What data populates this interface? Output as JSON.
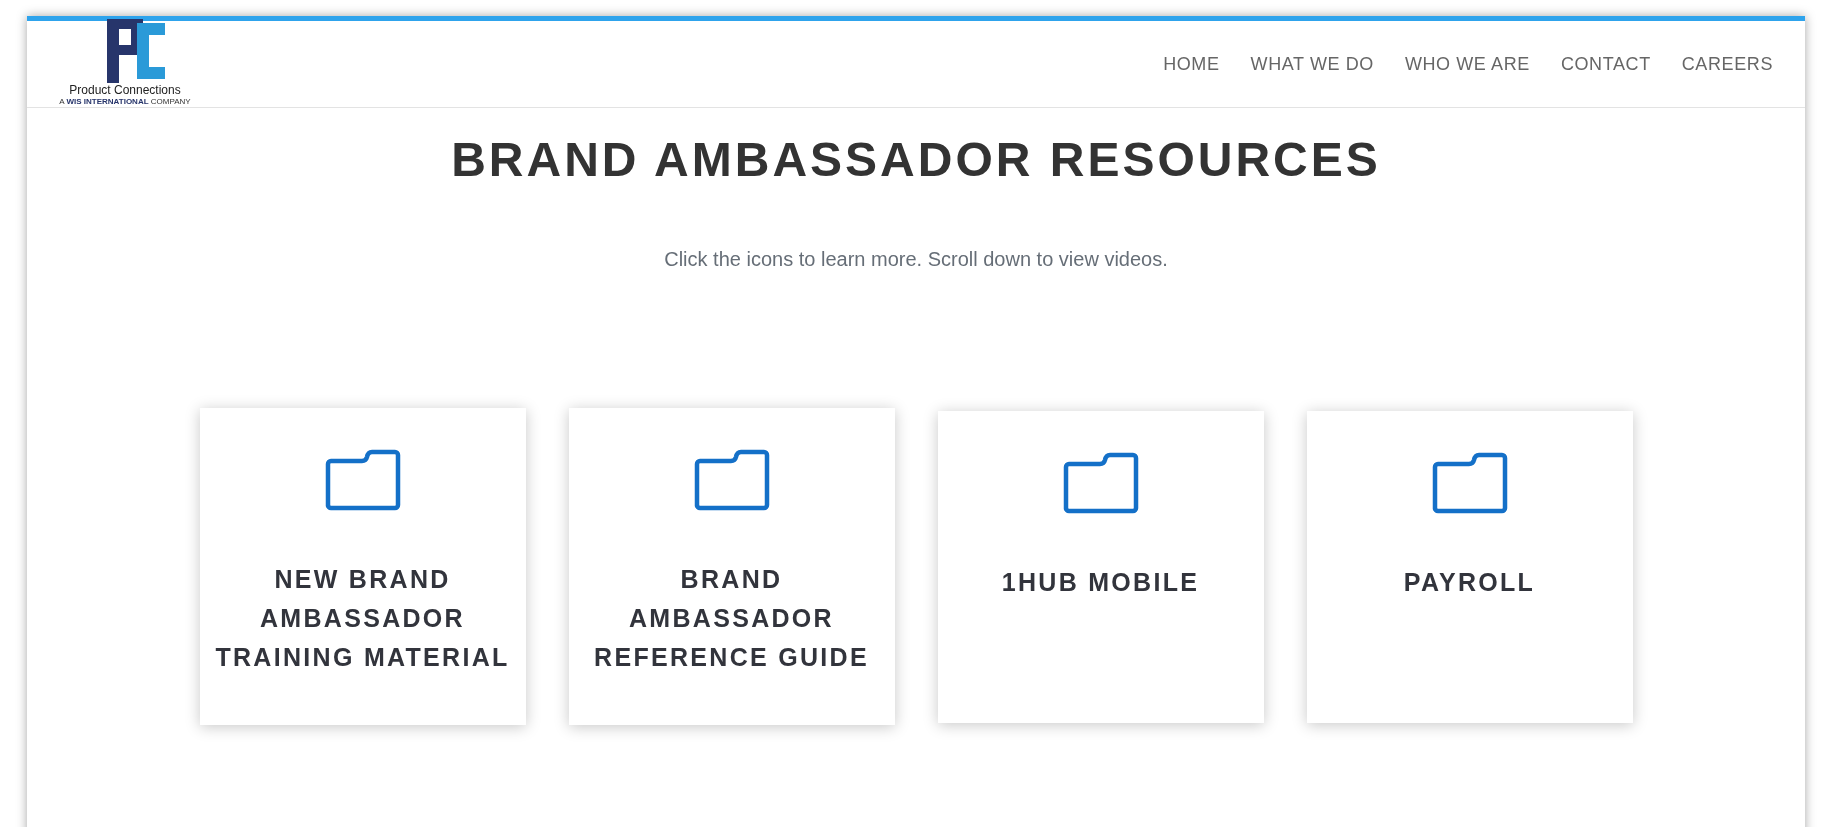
{
  "header": {
    "logo": {
      "name": "Product Connections",
      "tagline": "A **WIS INTERNATIONAL** COMPANY"
    },
    "nav": [
      {
        "label": "HOME"
      },
      {
        "label": "WHAT WE DO"
      },
      {
        "label": "WHO WE ARE"
      },
      {
        "label": "CONTACT"
      },
      {
        "label": "CAREERS"
      }
    ]
  },
  "title": "BRAND AMBASSADOR RESOURCES",
  "subtitle": "Click the icons to learn more. Scroll down to view videos.",
  "cards": [
    {
      "title": "NEW BRAND AMBASSADOR TRAINING MATERIAL"
    },
    {
      "title": "BRAND AMBASSADOR REFERENCE GUIDE"
    },
    {
      "title": "1HUB MOBILE"
    },
    {
      "title": "PAYROLL"
    }
  ]
}
